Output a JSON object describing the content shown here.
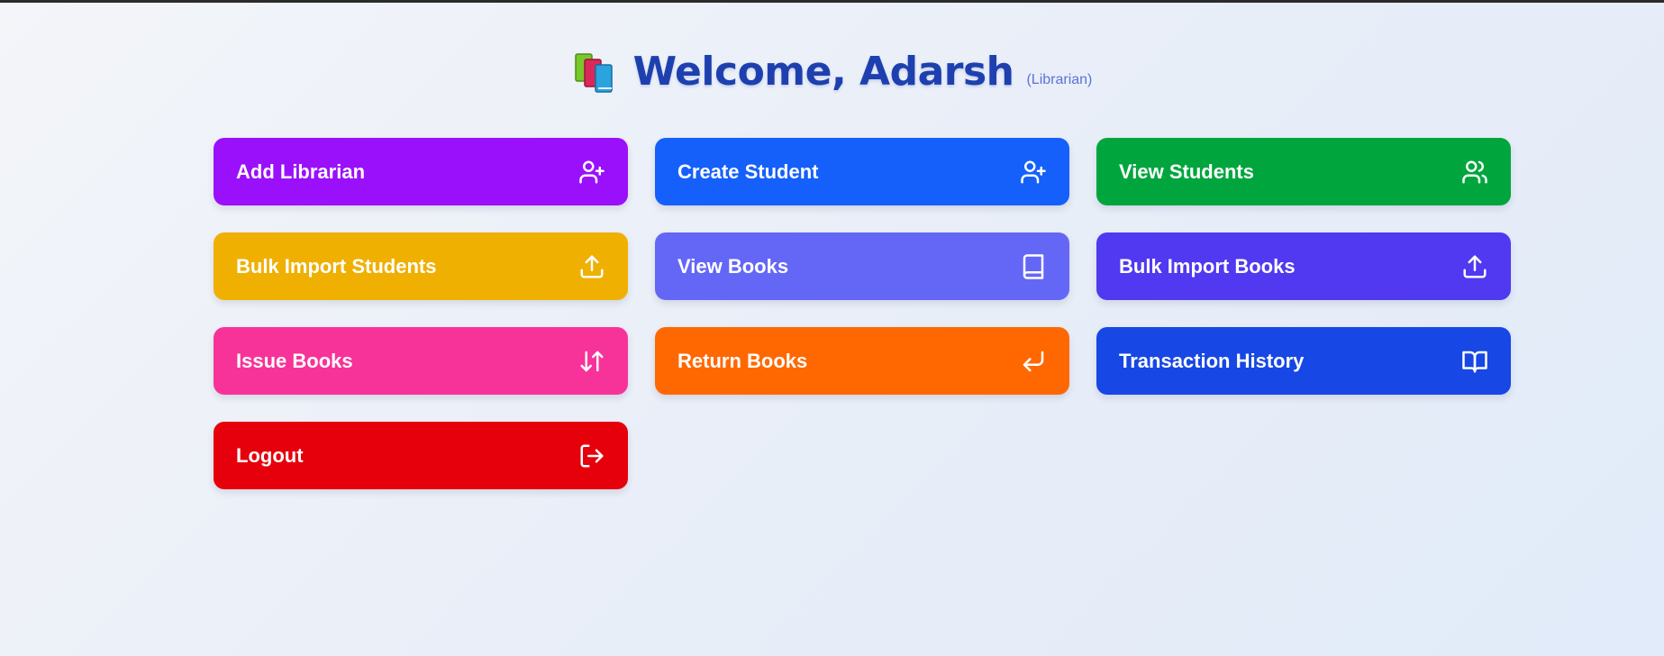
{
  "header": {
    "icon": "books-icon",
    "title": "Welcome, Adarsh",
    "role": "(Librarian)"
  },
  "buttons": [
    {
      "label": "Add Librarian",
      "icon": "user-plus-icon",
      "color": "#9a10fb"
    },
    {
      "label": "Create Student",
      "icon": "user-plus-icon",
      "color": "#1560fb"
    },
    {
      "label": "View Students",
      "icon": "users-icon",
      "color": "#00a63d"
    },
    {
      "label": "Bulk Import Students",
      "icon": "upload-icon",
      "color": "#efb002"
    },
    {
      "label": "View Books",
      "icon": "book-icon",
      "color": "#6467f6"
    },
    {
      "label": "Bulk Import Books",
      "icon": "upload-icon",
      "color": "#5039f0"
    },
    {
      "label": "Issue Books",
      "icon": "arrow-up-down-icon",
      "color": "#f73399"
    },
    {
      "label": "Return Books",
      "icon": "corner-down-left-icon",
      "color": "#ff6800"
    },
    {
      "label": "Transaction History",
      "icon": "book-open-icon",
      "color": "#1747e4"
    },
    {
      "label": "Logout",
      "icon": "log-out-icon",
      "color": "#e6000c"
    }
  ]
}
